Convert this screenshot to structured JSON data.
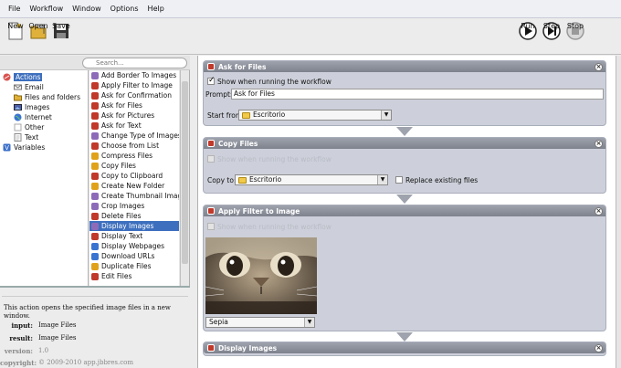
{
  "menu": [
    "File",
    "Workflow",
    "Window",
    "Options",
    "Help"
  ],
  "toolbar": {
    "new_label": "New",
    "open_label": "Open",
    "save_label": "Save",
    "run_label": "Run",
    "step_label": "Step",
    "stop_label": "Stop"
  },
  "search": {
    "placeholder": "Search..."
  },
  "tree": {
    "actions_label": "Actions",
    "items": [
      "Email",
      "Files and folders",
      "Images",
      "Internet",
      "Other",
      "Text"
    ],
    "variables_label": "Variables"
  },
  "actions_list": [
    "Add Border To Images",
    "Apply Filter to Image",
    "Ask for Confirmation",
    "Ask for Files",
    "Ask for Pictures",
    "Ask for Text",
    "Change Type of Images",
    "Choose from List",
    "Compress Files",
    "Copy Files",
    "Copy to Clipboard",
    "Create New Folder",
    "Create Thumbnail Image",
    "Crop Images",
    "Delete Files",
    "Display Images",
    "Display Text",
    "Display Webpages",
    "Download URLs",
    "Duplicate Files",
    "Edit Files"
  ],
  "description": {
    "text": "This action opens the specified image files in a new window.",
    "input_key": "input:",
    "input_val": "Image Files",
    "result_key": "result:",
    "result_val": "Image Files",
    "version_key": "version:",
    "version_val": "1.0",
    "copyright_key": "copyright:",
    "copyright_val": "© 2009-2010 app.jbbres.com"
  },
  "cards": {
    "ask_files": {
      "title": "Ask for Files",
      "show_label": "Show when running the workflow",
      "prompt_label": "Prompt:",
      "prompt_value": "Ask for Files",
      "start_label": "Start from",
      "start_value": "Escritorio"
    },
    "copy_files": {
      "title": "Copy Files",
      "show_label": "Show when running the workflow",
      "copy_to_label": "Copy to:",
      "copy_to_value": "Escritorio",
      "replace_label": "Replace existing files"
    },
    "apply_filter": {
      "title": "Apply Filter to Image",
      "show_label": "Show when running the workflow",
      "filter_value": "Sepia"
    },
    "display_images": {
      "title": "Display Images"
    }
  },
  "colors": {
    "selection": "#3d6fbe",
    "card_bg": "#cdd0da",
    "card_header": "#8e929d"
  }
}
